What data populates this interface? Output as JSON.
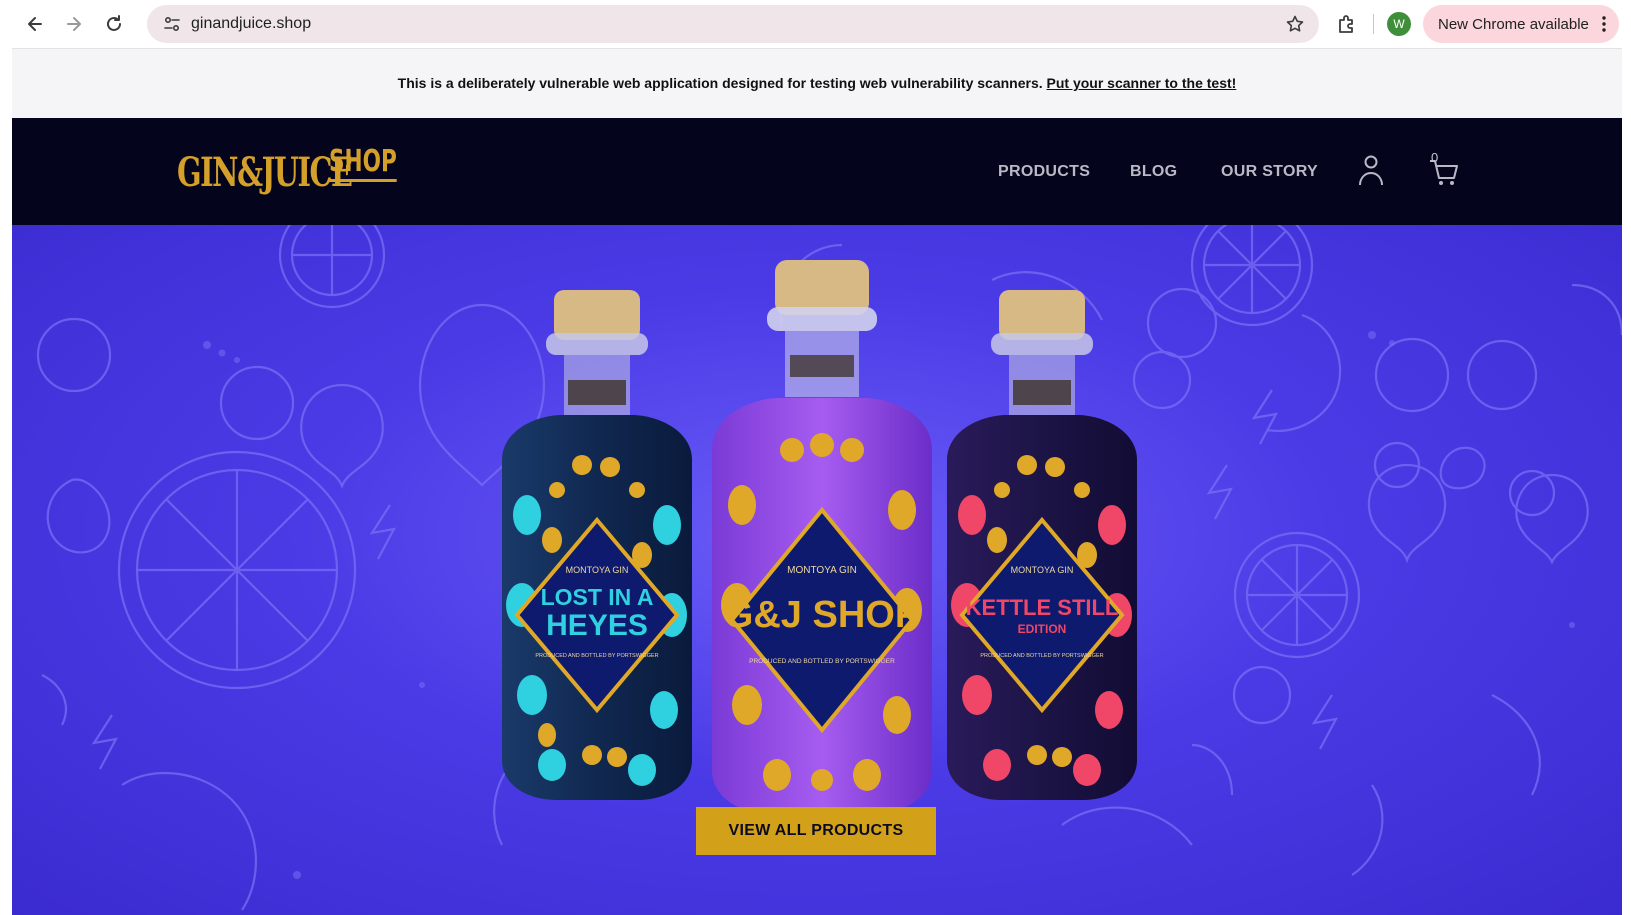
{
  "browser": {
    "url": "ginandjuice.shop",
    "profile_initial": "W",
    "update_label": "New Chrome available",
    "icons": [
      "back-icon",
      "forward-icon",
      "reload-icon",
      "site-settings-icon",
      "bookmark-star-icon",
      "extensions-icon",
      "more-vert-icon"
    ]
  },
  "notice": {
    "text": "This is a deliberately vulnerable web application designed for testing web vulnerability scanners.",
    "link": "Put your scanner to the test!"
  },
  "header": {
    "logo_main": "GIN&JUICE",
    "logo_shop": "SHOP",
    "nav": [
      "PRODUCTS",
      "BLOG",
      "OUR STORY"
    ],
    "cart_count": "0"
  },
  "hero": {
    "cta": "VIEW ALL PRODUCTS",
    "bottles": [
      {
        "brand": "MONTOYA GIN",
        "name_line1": "LOST IN A",
        "name_line2": "HEYES",
        "small": "PRODUCED AND BOTTLED BY PORTSWIGGER",
        "color": "#29c6d8"
      },
      {
        "brand": "MONTOYA GIN",
        "name_line1": "G&J SHOP",
        "name_line2": "",
        "small": "PRODUCED AND BOTTLED BY PORTSWIGGER",
        "color": "#a65cf0"
      },
      {
        "brand": "MONTOYA GIN",
        "name_line1": "KETTLE STILL",
        "name_line2": "EDITION",
        "small": "PRODUCED AND BOTTLED BY PORTSWIGGER",
        "color": "#f04668"
      }
    ]
  },
  "colors": {
    "header_bg": "#04041c",
    "gold": "#d4a02a",
    "hero_bg": "#4b3be6",
    "notice_bg": "#f5f5f7"
  }
}
